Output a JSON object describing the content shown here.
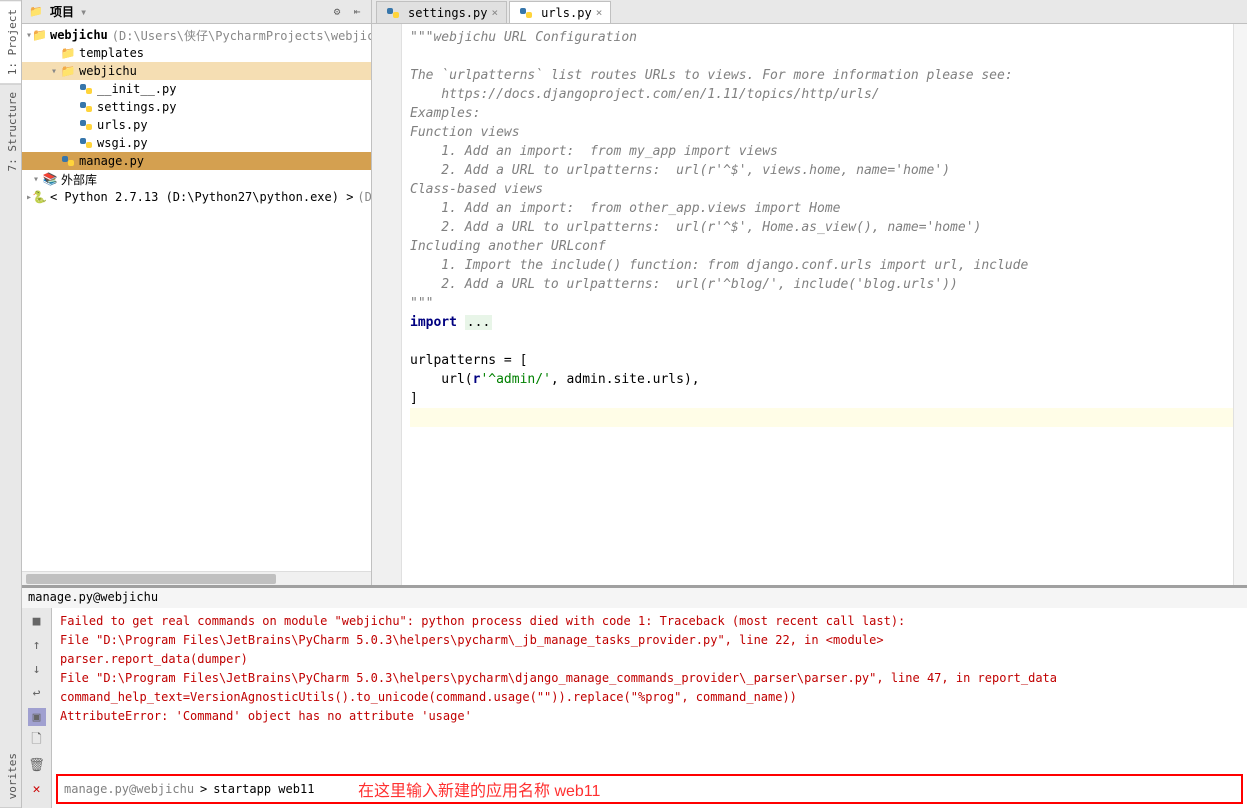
{
  "leftTabs": [
    "1: Project",
    "7: Structure"
  ],
  "bottomTabs": [
    "vorites"
  ],
  "projectPanel": {
    "title": "项目",
    "tree": [
      {
        "depth": 0,
        "toggle": "▾",
        "icon": "folder",
        "bold": true,
        "label": "webjichu",
        "path": "(D:\\Users\\侠仔\\PycharmProjects\\webjichu)"
      },
      {
        "depth": 1,
        "toggle": "",
        "icon": "folder",
        "label": "templates"
      },
      {
        "depth": 1,
        "toggle": "▾",
        "icon": "folder",
        "label": "webjichu",
        "selected": "child"
      },
      {
        "depth": 2,
        "toggle": "",
        "icon": "py",
        "label": "__init__.py"
      },
      {
        "depth": 2,
        "toggle": "",
        "icon": "py",
        "label": "settings.py"
      },
      {
        "depth": 2,
        "toggle": "",
        "icon": "py",
        "label": "urls.py"
      },
      {
        "depth": 2,
        "toggle": "",
        "icon": "py",
        "label": "wsgi.py"
      },
      {
        "depth": 1,
        "toggle": "",
        "icon": "py",
        "label": "manage.py",
        "selected": "row"
      },
      {
        "depth": 0,
        "toggle": "▾",
        "icon": "lib",
        "label": "外部库"
      },
      {
        "depth": 1,
        "toggle": "▸",
        "icon": "python",
        "label": "< Python 2.7.13 (D:\\Python27\\python.exe) >",
        "path": " (D:"
      }
    ]
  },
  "editor": {
    "tabs": [
      {
        "icon": "py",
        "label": "settings.py",
        "active": false
      },
      {
        "icon": "py",
        "label": "urls.py",
        "active": true
      }
    ],
    "lines": [
      {
        "cls": "docstring",
        "text": "\"\"\"webjichu URL Configuration"
      },
      {
        "cls": "docstring",
        "text": ""
      },
      {
        "cls": "docstring",
        "text": "The `urlpatterns` list routes URLs to views. For more information please see:"
      },
      {
        "cls": "docstring",
        "text": "    https://docs.djangoproject.com/en/1.11/topics/http/urls/"
      },
      {
        "cls": "docstring",
        "text": "Examples:"
      },
      {
        "cls": "docstring",
        "text": "Function views"
      },
      {
        "cls": "docstring",
        "text": "    1. Add an import:  from my_app import views"
      },
      {
        "cls": "docstring",
        "text": "    2. Add a URL to urlpatterns:  url(r'^$', views.home, name='home')"
      },
      {
        "cls": "docstring",
        "text": "Class-based views"
      },
      {
        "cls": "docstring",
        "text": "    1. Add an import:  from other_app.views import Home"
      },
      {
        "cls": "docstring",
        "text": "    2. Add a URL to urlpatterns:  url(r'^$', Home.as_view(), name='home')"
      },
      {
        "cls": "docstring",
        "text": "Including another URLconf"
      },
      {
        "cls": "docstring",
        "text": "    1. Import the include() function: from django.conf.urls import url, include"
      },
      {
        "cls": "docstring",
        "text": "    2. Add a URL to urlpatterns:  url(r'^blog/', include('blog.urls'))"
      },
      {
        "cls": "docstring",
        "text": "\"\"\""
      },
      {
        "cls": "fold",
        "html": "<span class='keyword'>import</span> <span class='fold-bg'>...</span>"
      },
      {
        "cls": "",
        "text": ""
      },
      {
        "cls": "",
        "text": "urlpatterns = ["
      },
      {
        "cls": "",
        "html": "    url(<span class='keyword'>r</span><span class='string'>'^admin/'</span>, admin.site.urls),"
      },
      {
        "cls": "",
        "text": "]"
      },
      {
        "cls": "highlight",
        "text": ""
      }
    ]
  },
  "console": {
    "title": "manage.py@webjichu",
    "output": [
      "Failed to get real commands on module \"webjichu\": python process died with code 1: Traceback (most recent call last):",
      "  File \"D:\\Program Files\\JetBrains\\PyCharm 5.0.3\\helpers\\pycharm\\_jb_manage_tasks_provider.py\", line 22, in <module>",
      "    parser.report_data(dumper)",
      "  File \"D:\\Program Files\\JetBrains\\PyCharm 5.0.3\\helpers\\pycharm\\django_manage_commands_provider\\_parser\\parser.py\", line 47, in report_data",
      "    command_help_text=VersionAgnosticUtils().to_unicode(command.usage(\"\")).replace(\"%prog\", command_name))",
      "AttributeError: 'Command' object has no attribute 'usage'"
    ],
    "promptLabel": "manage.py@webjichu",
    "promptChevron": ">",
    "promptValue": "startapp web11",
    "annotation": "在这里输入新建的应用名称  web11"
  }
}
